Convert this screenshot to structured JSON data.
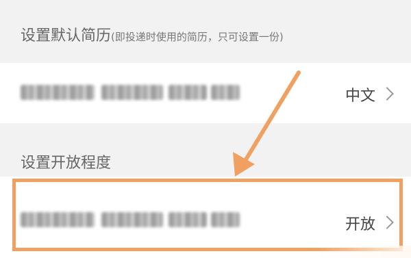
{
  "default_resume": {
    "header": "设置默认简历",
    "header_note": "(即投递时使用的简历，只可设置一份)",
    "value": "中文"
  },
  "open_level": {
    "header": "设置开放程度",
    "value": "开放"
  },
  "colors": {
    "highlight": "#f0a060",
    "arrow": "#f0a060",
    "background": "#f2f2f2",
    "row_background": "#ffffff"
  }
}
